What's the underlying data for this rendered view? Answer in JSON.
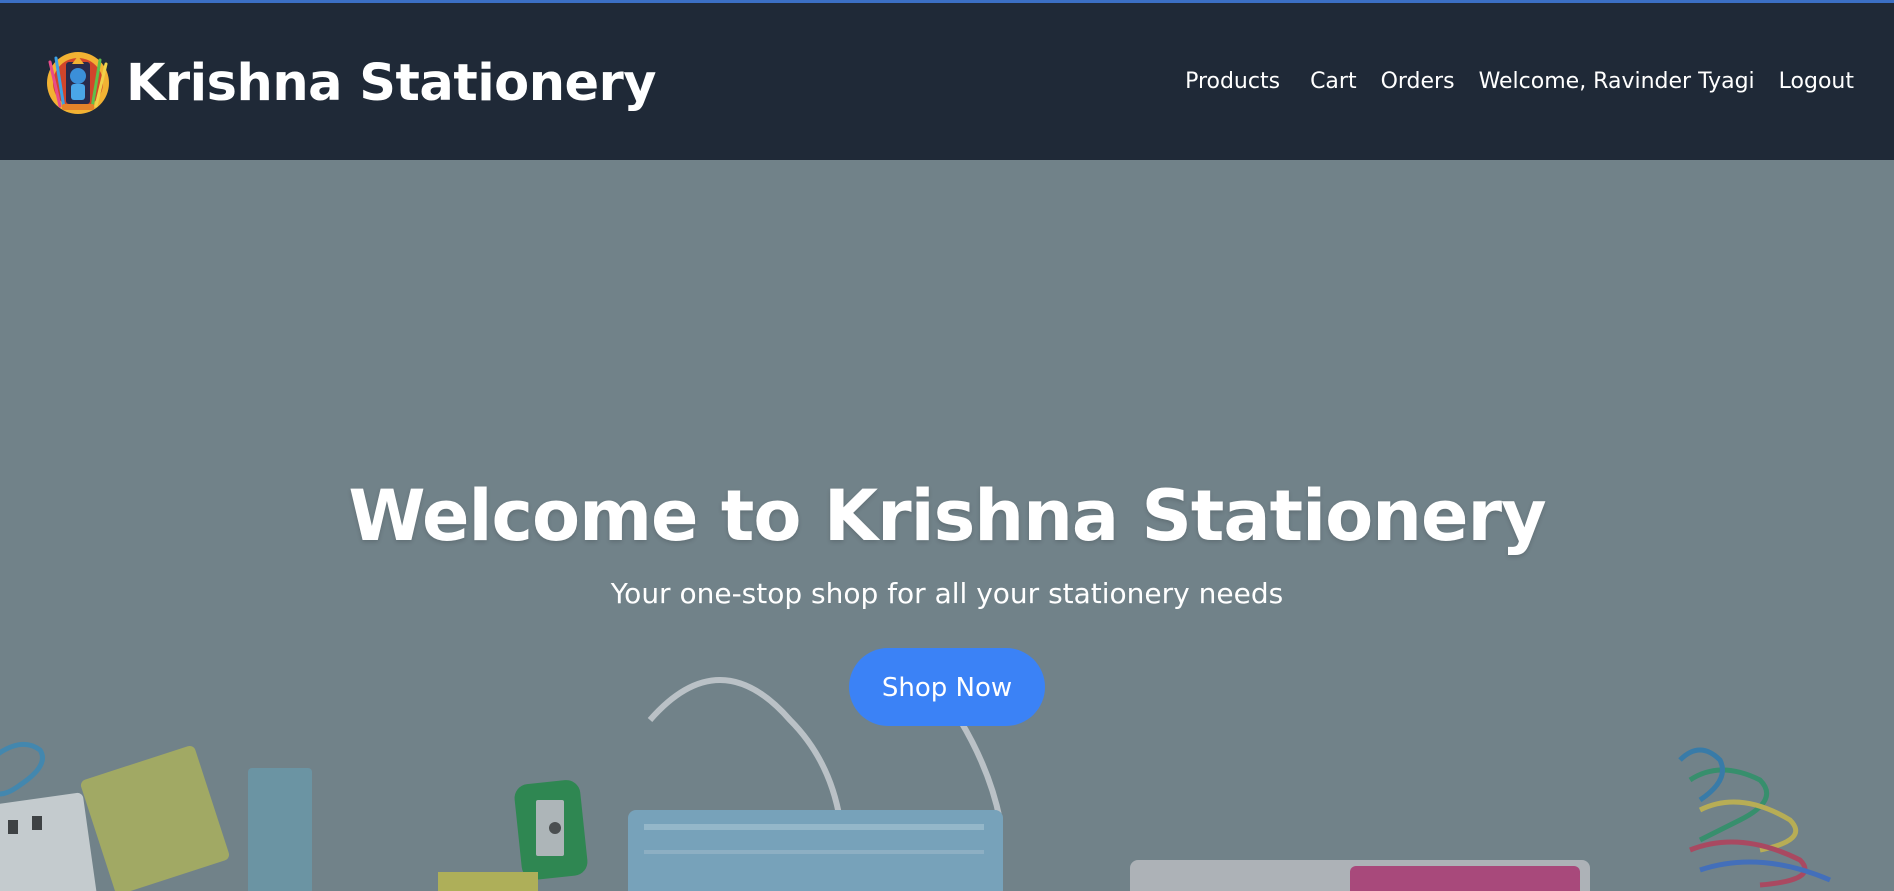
{
  "navbar": {
    "brand_name": "Krishna Stationery",
    "logo_icon": "krishna-logo-icon",
    "links": {
      "products": "Products",
      "cart": "Cart",
      "orders": "Orders",
      "welcome": "Welcome, Ravinder Tyagi",
      "logout": "Logout"
    },
    "colors": {
      "background": "#1f2937",
      "text": "#ffffff"
    }
  },
  "hero": {
    "title": "Welcome to Krishna Stationery",
    "subtitle": "Your one-stop shop for all your stationery needs",
    "cta_label": "Shop Now",
    "colors": {
      "button": "#3b82f6",
      "overlay": "#76898f"
    }
  }
}
